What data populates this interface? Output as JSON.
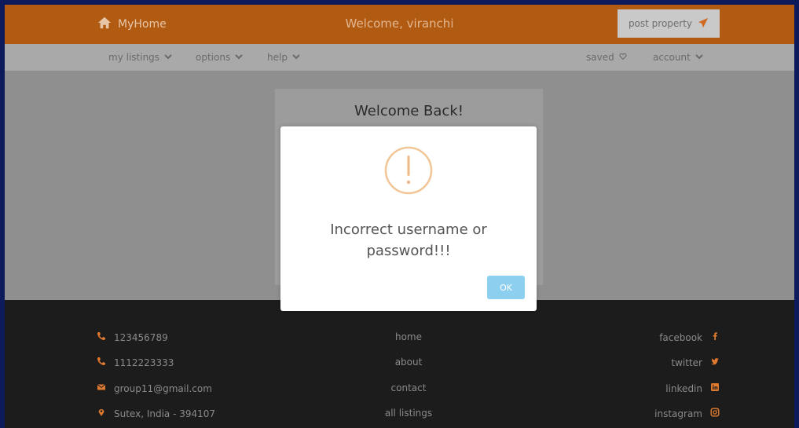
{
  "header": {
    "brand": "MyHome",
    "welcome": "Welcome, viranchi",
    "post_label": "post property"
  },
  "nav": {
    "left": [
      "my listings",
      "options",
      "help"
    ],
    "saved": "saved",
    "account": "account"
  },
  "login_card": {
    "title": "Welcome Back!"
  },
  "modal": {
    "message_line1": "Incorrect username or",
    "message_line2": "password!!!",
    "ok_label": "OK"
  },
  "footer": {
    "contacts": [
      {
        "icon": "phone-icon",
        "text": "123456789"
      },
      {
        "icon": "phone-icon",
        "text": "1112223333"
      },
      {
        "icon": "envelope-icon",
        "text": "group11@gmail.com"
      },
      {
        "icon": "location-pin-icon",
        "text": "Sutex, India - 394107"
      }
    ],
    "links": [
      "home",
      "about",
      "contact",
      "all listings"
    ],
    "social": [
      {
        "icon": "facebook-icon",
        "text": "facebook"
      },
      {
        "icon": "twitter-icon",
        "text": "twitter"
      },
      {
        "icon": "linkedin-icon",
        "text": "linkedin"
      },
      {
        "icon": "instagram-icon",
        "text": "instagram"
      }
    ]
  },
  "colors": {
    "header_bg": "#b05a12",
    "accent_orange": "#e07a2e",
    "nav_bg": "#a9a9a9",
    "overlay_bg": "#8f8f8f",
    "footer_bg": "#1c1c1c",
    "ok_button": "#8dcfee",
    "outer_border": "#0d1a5c"
  }
}
